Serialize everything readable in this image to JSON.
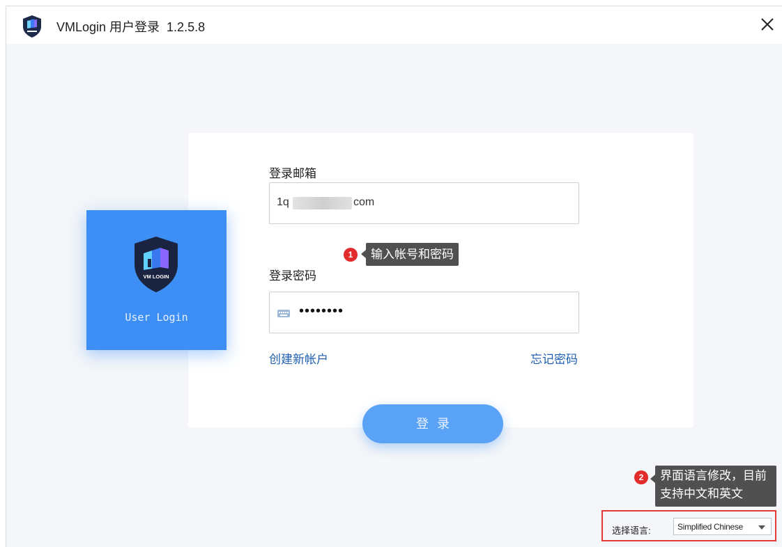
{
  "window": {
    "title": "VMLogin 用户登录  1.2.5.8"
  },
  "badge": {
    "logo_text": "VM LOGIN",
    "label": "User Login"
  },
  "form": {
    "email_label": "登录邮箱",
    "email_prefix": "1q",
    "email_suffix": "com",
    "password_label": "登录密码",
    "password_value": "••••••••",
    "create_account": "创建新帐户",
    "forgot_password": "忘记密码",
    "login_button": "登录"
  },
  "annotations": [
    {
      "number": "1",
      "text": "输入帐号和密码"
    },
    {
      "number": "2",
      "line1": "界面语言修改，目前",
      "line2": "支持中文和英文"
    }
  ],
  "language": {
    "label": "选择语言:",
    "selected": "Simplified Chinese"
  },
  "colors": {
    "accent": "#3d8ff6",
    "button": "#5aa2f6",
    "link": "#1f5fb0",
    "annotation_badge": "#e22b2b",
    "highlight_border": "#e53935"
  },
  "icons": [
    "app-shield-icon",
    "close-icon",
    "keyboard-icon",
    "chevron-down-icon"
  ]
}
